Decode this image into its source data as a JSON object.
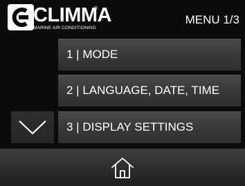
{
  "header": {
    "brand_name": "CLIMMA",
    "brand_registered": "®",
    "brand_tagline": "MARINE AIR CONDITIONING",
    "page_indicator": "MENU 1/3"
  },
  "menu": {
    "items": [
      {
        "label": "1 | MODE"
      },
      {
        "label": "2 | LANGUAGE, DATE, TIME"
      },
      {
        "label": "3 | DISPLAY SETTINGS"
      }
    ]
  },
  "controls": {
    "scroll_down_icon": "chevron-down-icon",
    "home_icon": "home-icon"
  },
  "colors": {
    "background": "#0b0b0b",
    "button": "#3a3a3a",
    "text": "#ffffff"
  }
}
